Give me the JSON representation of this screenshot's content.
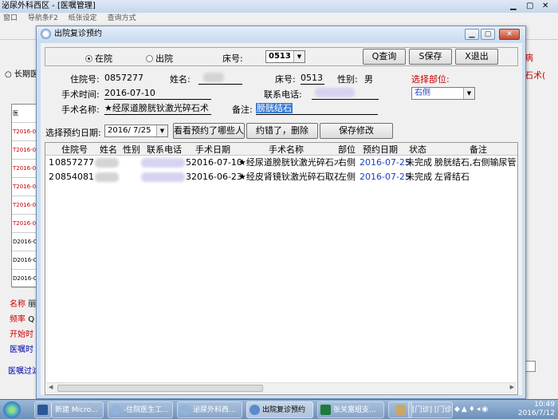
{
  "bg": {
    "title": "泌尿外科西区 - [医嘱管理]",
    "menu": [
      "窗口",
      "导航条F2",
      "纸张设定",
      "查询方式"
    ],
    "radio_long": "长期医",
    "grid_head": "医",
    "grid_rows": [
      "T2016-0",
      "T2016-0",
      "T2016-0",
      "T2016-0",
      "T2016-0",
      "T2016-0",
      "D2016-0",
      "D2016-0",
      "D2016-0",
      "D2016-0",
      "D2016-0"
    ],
    "left_labels": [
      "名称",
      "频率",
      "开始时",
      "医嘱时"
    ],
    "left_values": [
      "丽",
      "Q",
      "",
      ""
    ],
    "bottom_label": "医嘱过滤",
    "right_red": [
      "病",
      "石术("
    ]
  },
  "dialog": {
    "title": "出院复诊预约",
    "controls": {
      "min": "0",
      "max": "1",
      "close": "r"
    },
    "row1": {
      "radio_inhospital": "在院",
      "radio_discharged": "出院",
      "bed_label": "床号:",
      "bed_value": "0513",
      "btn_query": "Q查询",
      "btn_save": "S保存",
      "btn_exit": "X退出"
    },
    "info": {
      "patient_id_label": "住院号:",
      "patient_id": "0857277",
      "name_label": "姓名:",
      "bed_label": "床号:",
      "bed": "0513",
      "gender_label": "性别:",
      "gender": "男",
      "site_label": "选择部位:",
      "site_value": "右侧",
      "surgery_time_label": "手术时间:",
      "surgery_time": "2016-07-10",
      "phone_label": "联系电话:",
      "surgery_name_label": "手术名称:",
      "surgery_name": "★经尿道膀胱钬激光碎石术",
      "note_label": "备注:",
      "note": "膀胱结石"
    },
    "row3": {
      "date_label": "选择预约日期:",
      "date_value": "2016/ 7/25",
      "btn_view": "看看预约了哪些人",
      "btn_delete": "约错了，删除",
      "btn_save_changes": "保存修改"
    },
    "table": {
      "columns": [
        "住院号",
        "姓名",
        "性别",
        "联系电话",
        "手术日期",
        "手术名称",
        "部位",
        "预约日期",
        "状态",
        "备注"
      ],
      "rows": [
        {
          "idx": "1",
          "id": "0857277",
          "name": "",
          "gender": "",
          "phone": "5",
          "surgery_date": "2016-07-10",
          "surgery_name": "★经尿道膀胱钬激光碎石术",
          "site": "右侧",
          "appt_date": "2016-07-25",
          "status": "未完成",
          "note": "膀胱结石,右侧输尿管"
        },
        {
          "idx": "2",
          "id": "0854081",
          "name": "",
          "gender": "",
          "phone": "3",
          "surgery_date": "2016-06-23",
          "surgery_name": "★经皮肾镜钬激光碎石取石术",
          "site": "左侧",
          "appt_date": "2016-07-25",
          "status": "未完成",
          "note": "左肾结石"
        }
      ]
    }
  },
  "taskbar": {
    "items": [
      "",
      "新建 Micro...",
      "-住院医生工...",
      "泌尿外科西...",
      "出院复诊预约",
      "张关富组支...",
      "",
      "[门诊] [门诊..."
    ],
    "time": "10:49",
    "date": "2016/7/12",
    "accent": "#6c8fb9"
  }
}
